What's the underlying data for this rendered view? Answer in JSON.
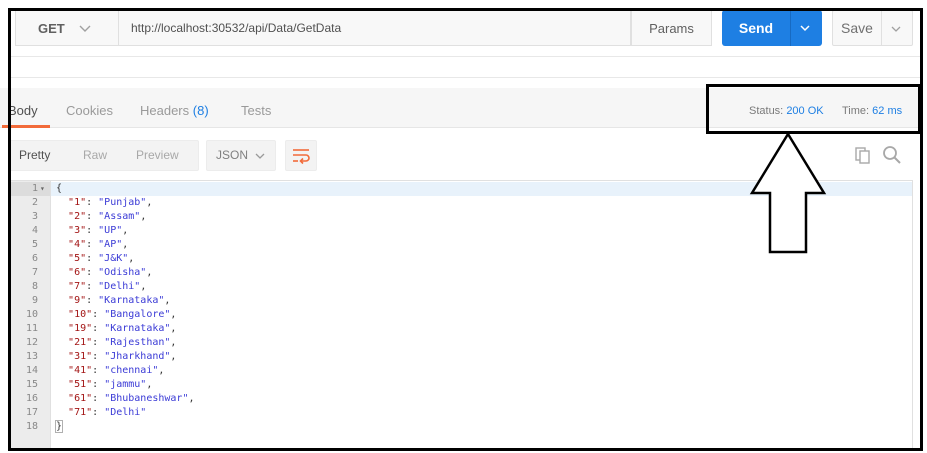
{
  "request": {
    "method": "GET",
    "url": "http://localhost:30532/api/Data/GetData",
    "params_label": "Params",
    "send_label": "Send",
    "save_label": "Save"
  },
  "tabs": {
    "body": "Body",
    "cookies": "Cookies",
    "headers": "Headers",
    "headers_count": "(8)",
    "tests": "Tests"
  },
  "status": {
    "status_label": "Status:",
    "status_value": "200 OK",
    "time_label": "Time:",
    "time_value": "62 ms"
  },
  "format": {
    "pretty": "Pretty",
    "raw": "Raw",
    "preview": "Preview",
    "language": "JSON"
  },
  "response_lines": [
    {
      "num": "1",
      "open": "{"
    },
    {
      "num": "2",
      "key": "\"1\"",
      "value": "\"Punjab\"",
      "comma": ","
    },
    {
      "num": "3",
      "key": "\"2\"",
      "value": "\"Assam\"",
      "comma": ","
    },
    {
      "num": "4",
      "key": "\"3\"",
      "value": "\"UP\"",
      "comma": ","
    },
    {
      "num": "5",
      "key": "\"4\"",
      "value": "\"AP\"",
      "comma": ","
    },
    {
      "num": "6",
      "key": "\"5\"",
      "value": "\"J&K\"",
      "comma": ","
    },
    {
      "num": "7",
      "key": "\"6\"",
      "value": "\"Odisha\"",
      "comma": ","
    },
    {
      "num": "8",
      "key": "\"7\"",
      "value": "\"Delhi\"",
      "comma": ","
    },
    {
      "num": "9",
      "key": "\"9\"",
      "value": "\"Karnataka\"",
      "comma": ","
    },
    {
      "num": "10",
      "key": "\"10\"",
      "value": "\"Bangalore\"",
      "comma": ","
    },
    {
      "num": "11",
      "key": "\"19\"",
      "value": "\"Karnataka\"",
      "comma": ","
    },
    {
      "num": "12",
      "key": "\"21\"",
      "value": "\"Rajesthan\"",
      "comma": ","
    },
    {
      "num": "13",
      "key": "\"31\"",
      "value": "\"Jharkhand\"",
      "comma": ","
    },
    {
      "num": "14",
      "key": "\"41\"",
      "value": "\"chennai\"",
      "comma": ","
    },
    {
      "num": "15",
      "key": "\"51\"",
      "value": "\"jammu\"",
      "comma": ","
    },
    {
      "num": "16",
      "key": "\"61\"",
      "value": "\"Bhubaneshwar\"",
      "comma": ","
    },
    {
      "num": "17",
      "key": "\"71\"",
      "value": "\"Delhi\"",
      "comma": ""
    },
    {
      "num": "18",
      "close": "}"
    }
  ],
  "icons": {
    "method_dropdown": "chevron-down-icon",
    "send_dropdown": "chevron-down-icon",
    "save_dropdown": "chevron-down-icon",
    "wrap": "wrap-lines-icon",
    "copy": "copy-icon",
    "search": "search-icon",
    "fold": "fold-caret-icon",
    "annotation": "up-arrow-icon"
  },
  "colors": {
    "accent_blue": "#1e7fe3",
    "tab_underline": "#f26b3a",
    "json_key": "#a31515",
    "json_value": "#3b3bd6"
  }
}
